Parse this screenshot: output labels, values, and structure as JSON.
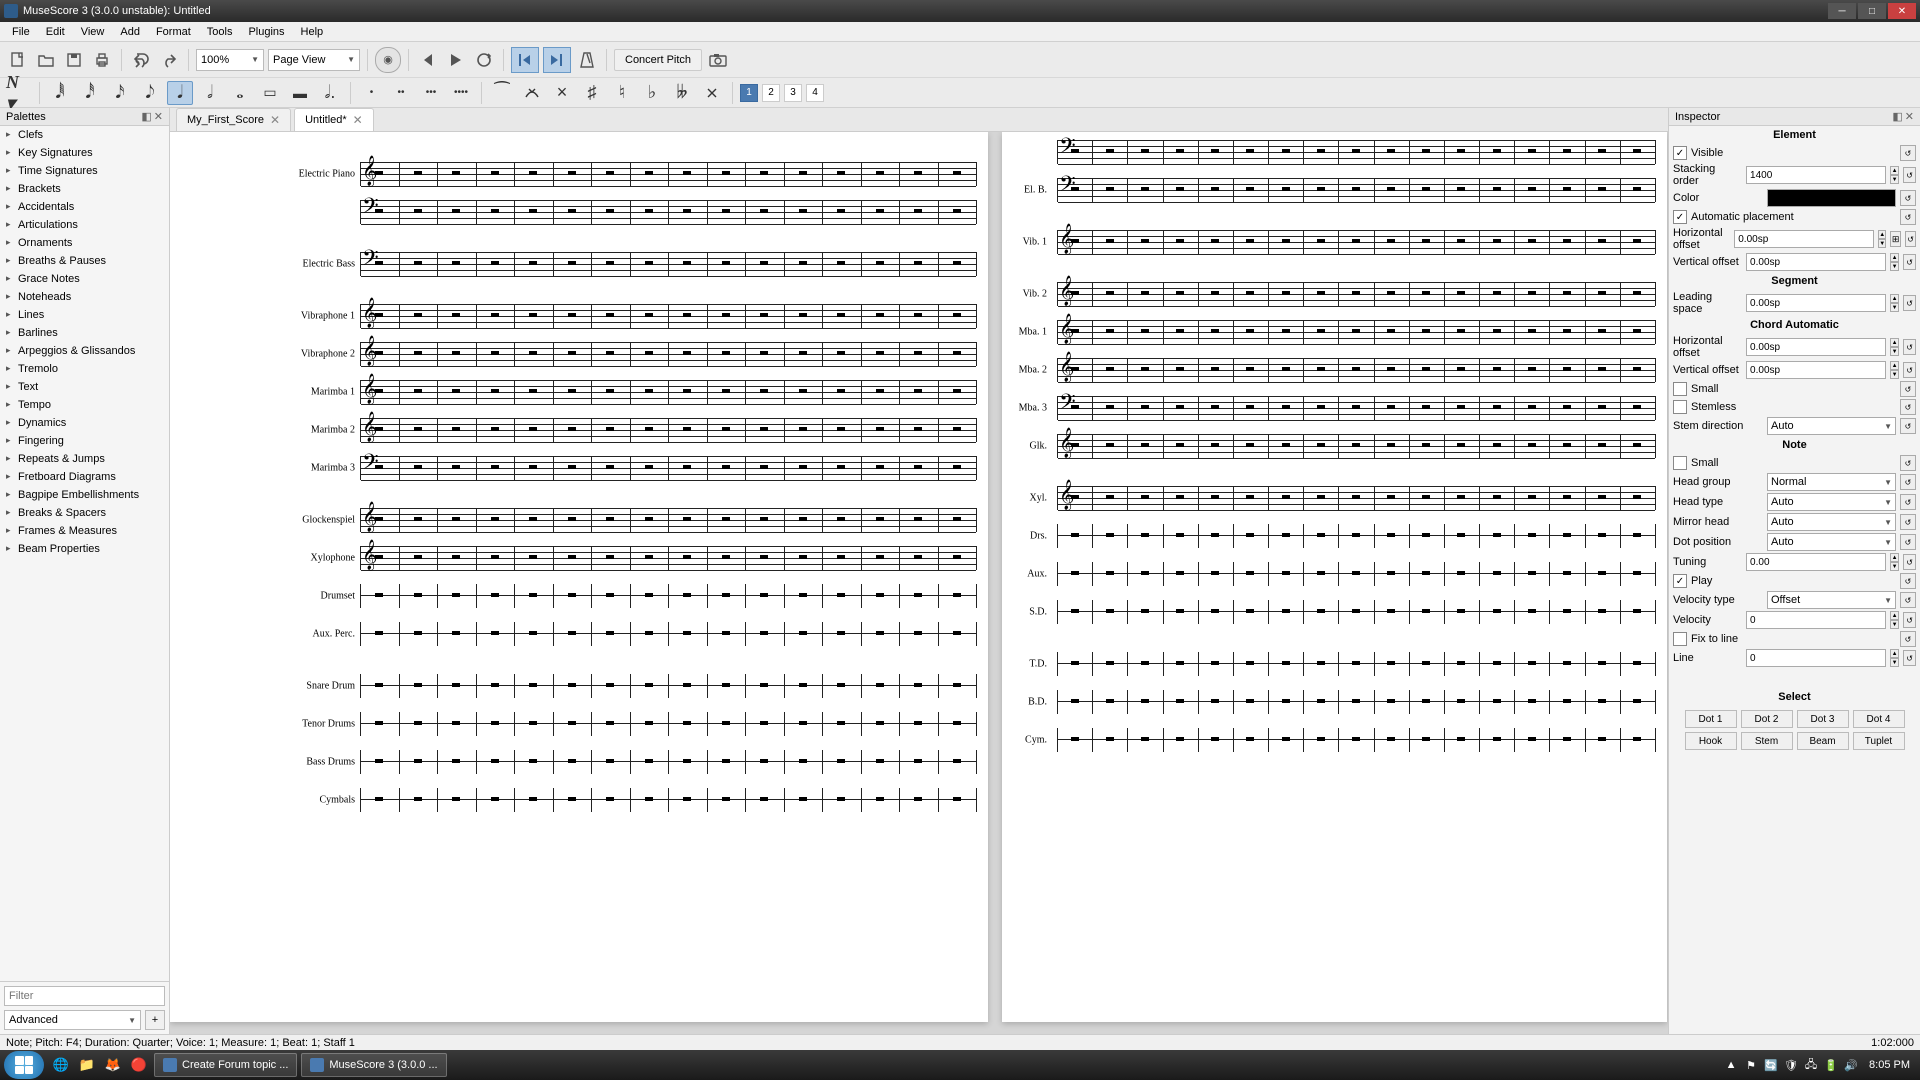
{
  "titlebar": {
    "text": "MuseScore 3 (3.0.0 unstable): Untitled"
  },
  "menu": [
    "File",
    "Edit",
    "View",
    "Add",
    "Format",
    "Tools",
    "Plugins",
    "Help"
  ],
  "toolbar": {
    "zoom": "100%",
    "view_mode": "Page View",
    "concert_pitch": "Concert Pitch"
  },
  "voices": [
    "1",
    "2",
    "3",
    "4"
  ],
  "palettes": {
    "title": "Palettes",
    "items": [
      "Clefs",
      "Key Signatures",
      "Time Signatures",
      "Brackets",
      "Accidentals",
      "Articulations",
      "Ornaments",
      "Breaths & Pauses",
      "Grace Notes",
      "Noteheads",
      "Lines",
      "Barlines",
      "Arpeggios & Glissandos",
      "Tremolo",
      "Text",
      "Tempo",
      "Dynamics",
      "Fingering",
      "Repeats & Jumps",
      "Fretboard Diagrams",
      "Bagpipe Embellishments",
      "Breaks & Spacers",
      "Frames & Measures",
      "Beam Properties"
    ],
    "filter_placeholder": "Filter",
    "advanced": "Advanced",
    "add": "+"
  },
  "tabs": [
    {
      "label": "My_First_Score",
      "active": false
    },
    {
      "label": "Untitled*",
      "active": true
    }
  ],
  "page1_instruments": [
    "Electric Piano",
    "",
    "Electric Bass",
    "Vibraphone 1",
    "Vibraphone 2",
    "Marimba 1",
    "Marimba 2",
    "Marimba 3",
    "Glockenspiel",
    "Xylophone",
    "Drumset",
    "Aux. Perc.",
    "Snare Drum",
    "Tenor Drums",
    "Bass Drums",
    "Cymbals"
  ],
  "page2_instruments": [
    "",
    "El. B.",
    "Vib. 1",
    "Vib. 2",
    "Mba. 1",
    "Mba. 2",
    "Mba. 3",
    "Glk.",
    "Xyl.",
    "Drs.",
    "Aux.",
    "S.D.",
    "T.D.",
    "B.D.",
    "Cym."
  ],
  "inspector": {
    "title": "Inspector",
    "sections": {
      "element": "Element",
      "segment": "Segment",
      "chord": "Chord Automatic",
      "note": "Note",
      "select": "Select"
    },
    "element": {
      "visible_label": "Visible",
      "visible": true,
      "stacking_label": "Stacking order",
      "stacking": "1400",
      "color_label": "Color",
      "autoplace_label": "Automatic placement",
      "autoplace": true,
      "hoff_label": "Horizontal offset",
      "hoff": "0.00sp",
      "voff_label": "Vertical offset",
      "voff": "0.00sp"
    },
    "segment": {
      "leading_label": "Leading space",
      "leading": "0.00sp"
    },
    "chord": {
      "hoff_label": "Horizontal offset",
      "hoff": "0.00sp",
      "voff_label": "Vertical offset",
      "voff": "0.00sp",
      "small_label": "Small",
      "small": false,
      "stemless_label": "Stemless",
      "stemless": false,
      "stemdir_label": "Stem direction",
      "stemdir": "Auto"
    },
    "note": {
      "small_label": "Small",
      "small": false,
      "headgroup_label": "Head group",
      "headgroup": "Normal",
      "headtype_label": "Head type",
      "headtype": "Auto",
      "mirror_label": "Mirror head",
      "mirror": "Auto",
      "dotpos_label": "Dot position",
      "dotpos": "Auto",
      "tuning_label": "Tuning",
      "tuning": "0.00",
      "play_label": "Play",
      "play": true,
      "veltype_label": "Velocity type",
      "veltype": "Offset",
      "velocity_label": "Velocity",
      "velocity": "0",
      "fixline_label": "Fix to line",
      "fixline": false,
      "line_label": "Line",
      "line": "0"
    },
    "select_buttons": [
      "Dot 1",
      "Dot 2",
      "Dot 3",
      "Dot 4",
      "Hook",
      "Stem",
      "Beam",
      "Tuplet"
    ]
  },
  "statusbar": {
    "left": "Note; Pitch: F4; Duration: Quarter; Voice: 1; Measure: 1; Beat: 1; Staff 1",
    "right": "1:02:000"
  },
  "taskbar": {
    "items": [
      "Create Forum topic ...",
      "MuseScore 3 (3.0.0 ..."
    ],
    "time": "8:05 PM"
  }
}
